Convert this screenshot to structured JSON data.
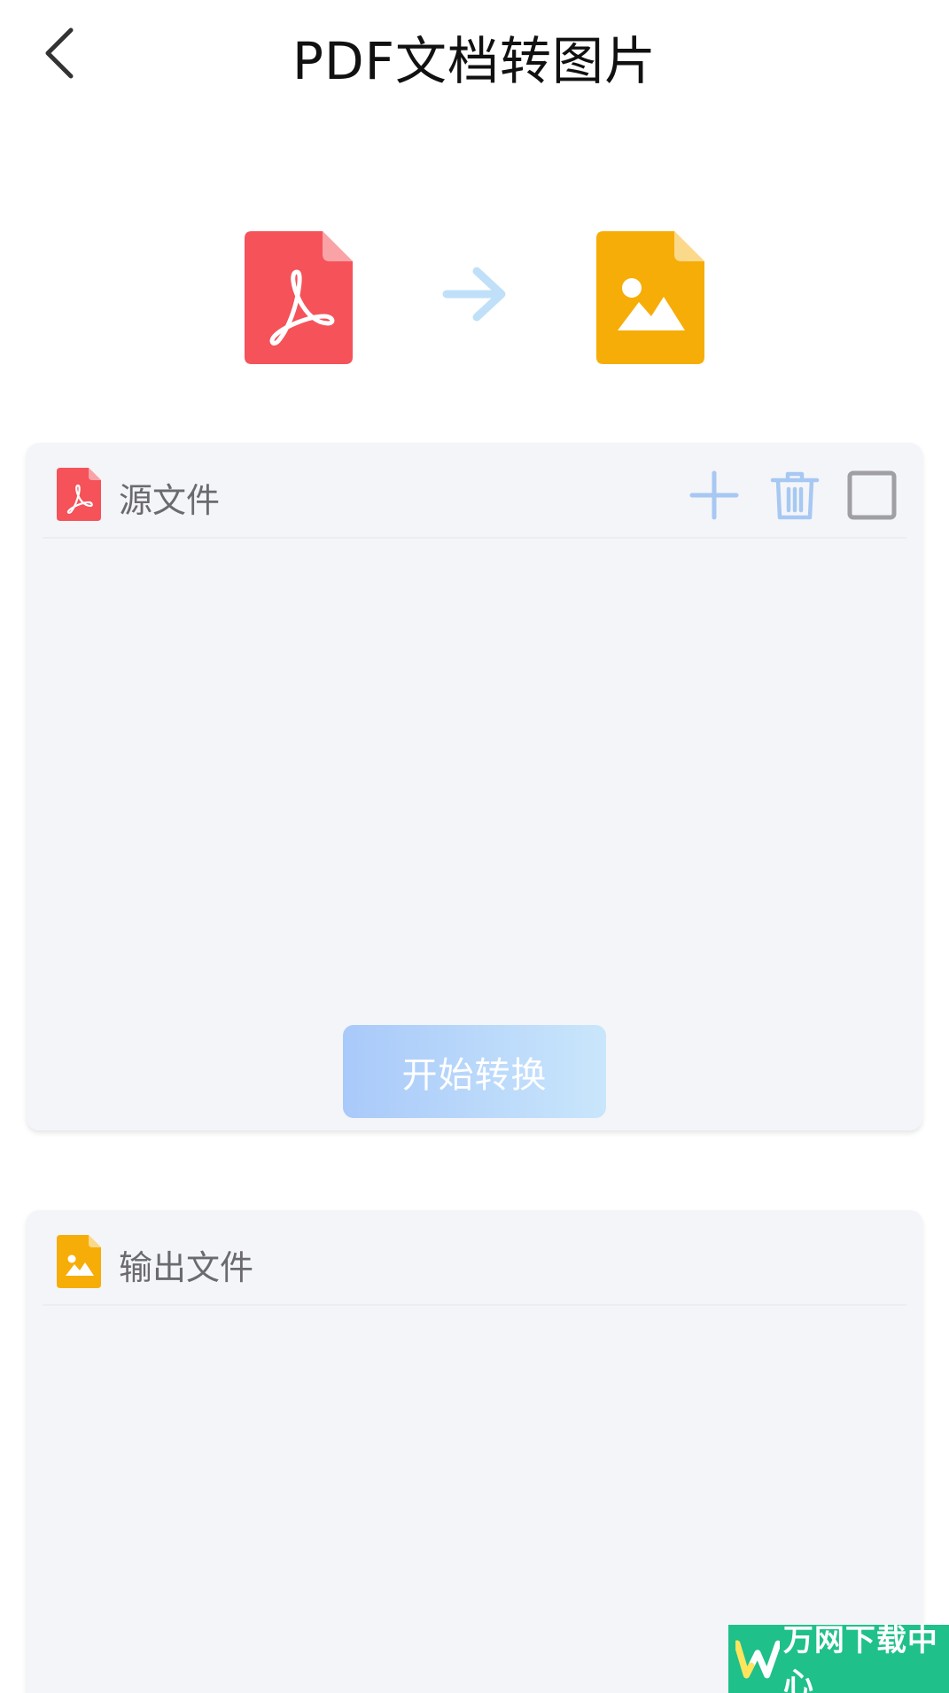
{
  "header": {
    "title": "PDF文档转图片"
  },
  "hero": {
    "from_icon": "pdf-file-icon",
    "arrow_icon": "arrow-right-icon",
    "to_icon": "image-file-icon"
  },
  "source_panel": {
    "label": "源文件",
    "icon": "pdf-file-icon",
    "actions": [
      "add-icon",
      "trash-icon",
      "checkbox-icon"
    ],
    "convert_button_label": "开始转换"
  },
  "output_panel": {
    "label": "输出文件",
    "icon": "image-file-icon"
  },
  "watermark": {
    "text": "万网下载中心"
  },
  "colors": {
    "pdf_red": "#f5525a",
    "image_orange": "#f6ad07",
    "arrow_blue": "#bfe0f8",
    "toolbar_blue": "#a7c8f2",
    "card_bg": "#f4f5f9",
    "watermark_green": "#1fc08a"
  }
}
